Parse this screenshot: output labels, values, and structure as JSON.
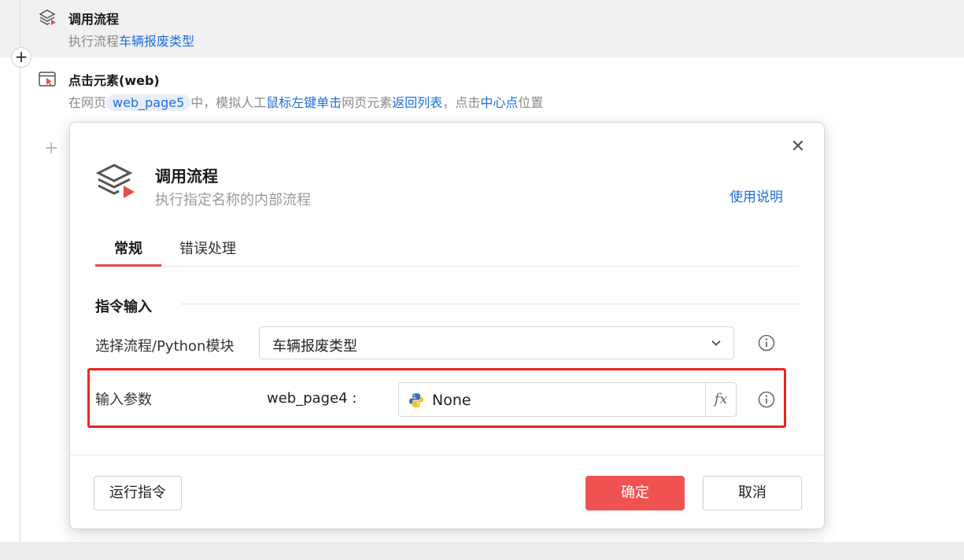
{
  "steps": [
    {
      "title": "调用流程",
      "desc_parts": [
        "执行流程",
        "车辆报废类型"
      ]
    },
    {
      "title": "点击元素(web)",
      "desc_parts": [
        "在网页",
        "web_page5",
        "中，模拟人工",
        "鼠标左键单击",
        "网页元素",
        "返回列表",
        "，点击",
        "中心点",
        "位置"
      ]
    }
  ],
  "add_button": "+",
  "ghost_add": "+",
  "dialog": {
    "close": "✕",
    "title": "调用流程",
    "subtitle": "执行指定名称的内部流程",
    "help_link": "使用说明",
    "tabs": [
      {
        "label": "常规",
        "active": true
      },
      {
        "label": "错误处理",
        "active": false
      }
    ],
    "section_title": "指令输入",
    "select_label": "选择流程/Python模块",
    "select_value": "车辆报废类型",
    "params_label": "输入参数",
    "param_name": "web_page4 :",
    "param_value": "None",
    "fx": "fx",
    "buttons": {
      "run": "运行指令",
      "ok": "确定",
      "cancel": "取消"
    }
  },
  "colors": {
    "accent": "#e84a4a",
    "link": "#1e6fd9",
    "ok_button": "#f05252",
    "highlight": "#ee2222"
  }
}
